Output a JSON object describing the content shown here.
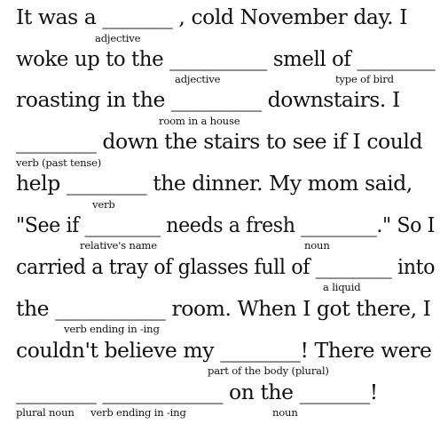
{
  "lines": [
    "It was a _______ , cold November day. I",
    "woke up to the __________ smell of ________",
    "roasting in the _________ downstairs. I",
    "________ down the stairs to see if I could",
    "help ________ the dinner. My mom said,",
    "\"See if ________ needs a fresh ________.\" So I",
    "carried a tray of glasses full of ________ into",
    "the ___________ room. When I got there, I",
    "couldn't believe my ________! There were",
    "________ ____________ on the _______!"
  ],
  "hints": {
    "adjective_1": "adjective",
    "adjective_2": "adjective",
    "type_of_bird": "type of bird",
    "room_in_a_house": "room in a house",
    "verb_past_tense": "verb (past tense)",
    "verb": "verb",
    "relatives_name": "relative's name",
    "noun_1": "noun",
    "a_liquid": "a liquid",
    "verb_ending_in_ing_1": "verb ending in -ing",
    "part_of_body_plural": "part of the body (plural)",
    "plural_noun": "plural noun",
    "verb_ending_in_ing_2": "verb ending in -ing",
    "noun_2": "noun"
  }
}
